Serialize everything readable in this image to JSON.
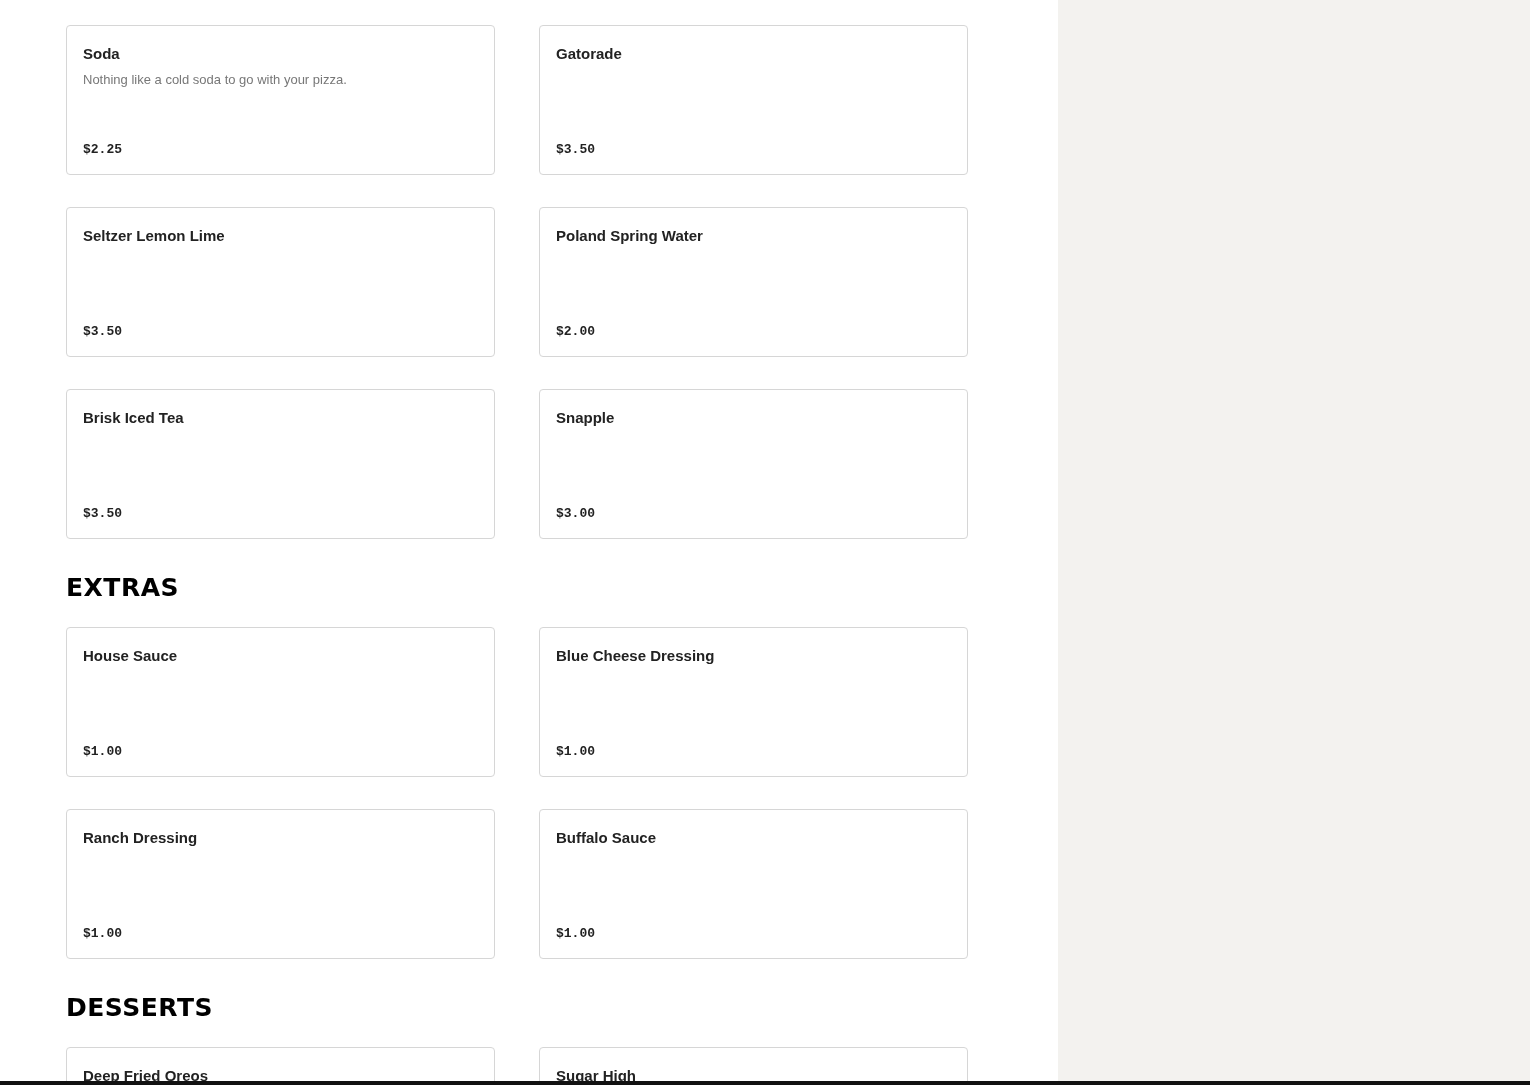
{
  "sections": [
    {
      "items": [
        {
          "name": "Soda",
          "description": "Nothing like a cold soda to go with your pizza.",
          "price": "$2.25"
        },
        {
          "name": "Gatorade",
          "price": "$3.50"
        },
        {
          "name": "Seltzer Lemon Lime",
          "price": "$3.50"
        },
        {
          "name": "Poland Spring Water",
          "price": "$2.00"
        },
        {
          "name": "Brisk Iced Tea",
          "price": "$3.50"
        },
        {
          "name": "Snapple",
          "price": "$3.00"
        }
      ]
    },
    {
      "title": "EXTRAS",
      "items": [
        {
          "name": "House Sauce",
          "price": "$1.00"
        },
        {
          "name": "Blue Cheese Dressing",
          "price": "$1.00"
        },
        {
          "name": "Ranch Dressing",
          "price": "$1.00"
        },
        {
          "name": "Buffalo Sauce",
          "price": "$1.00"
        }
      ]
    },
    {
      "title": "DESSERTS",
      "items": [
        {
          "name": "Deep Fried Oreos"
        },
        {
          "name": "Sugar High"
        }
      ]
    }
  ]
}
